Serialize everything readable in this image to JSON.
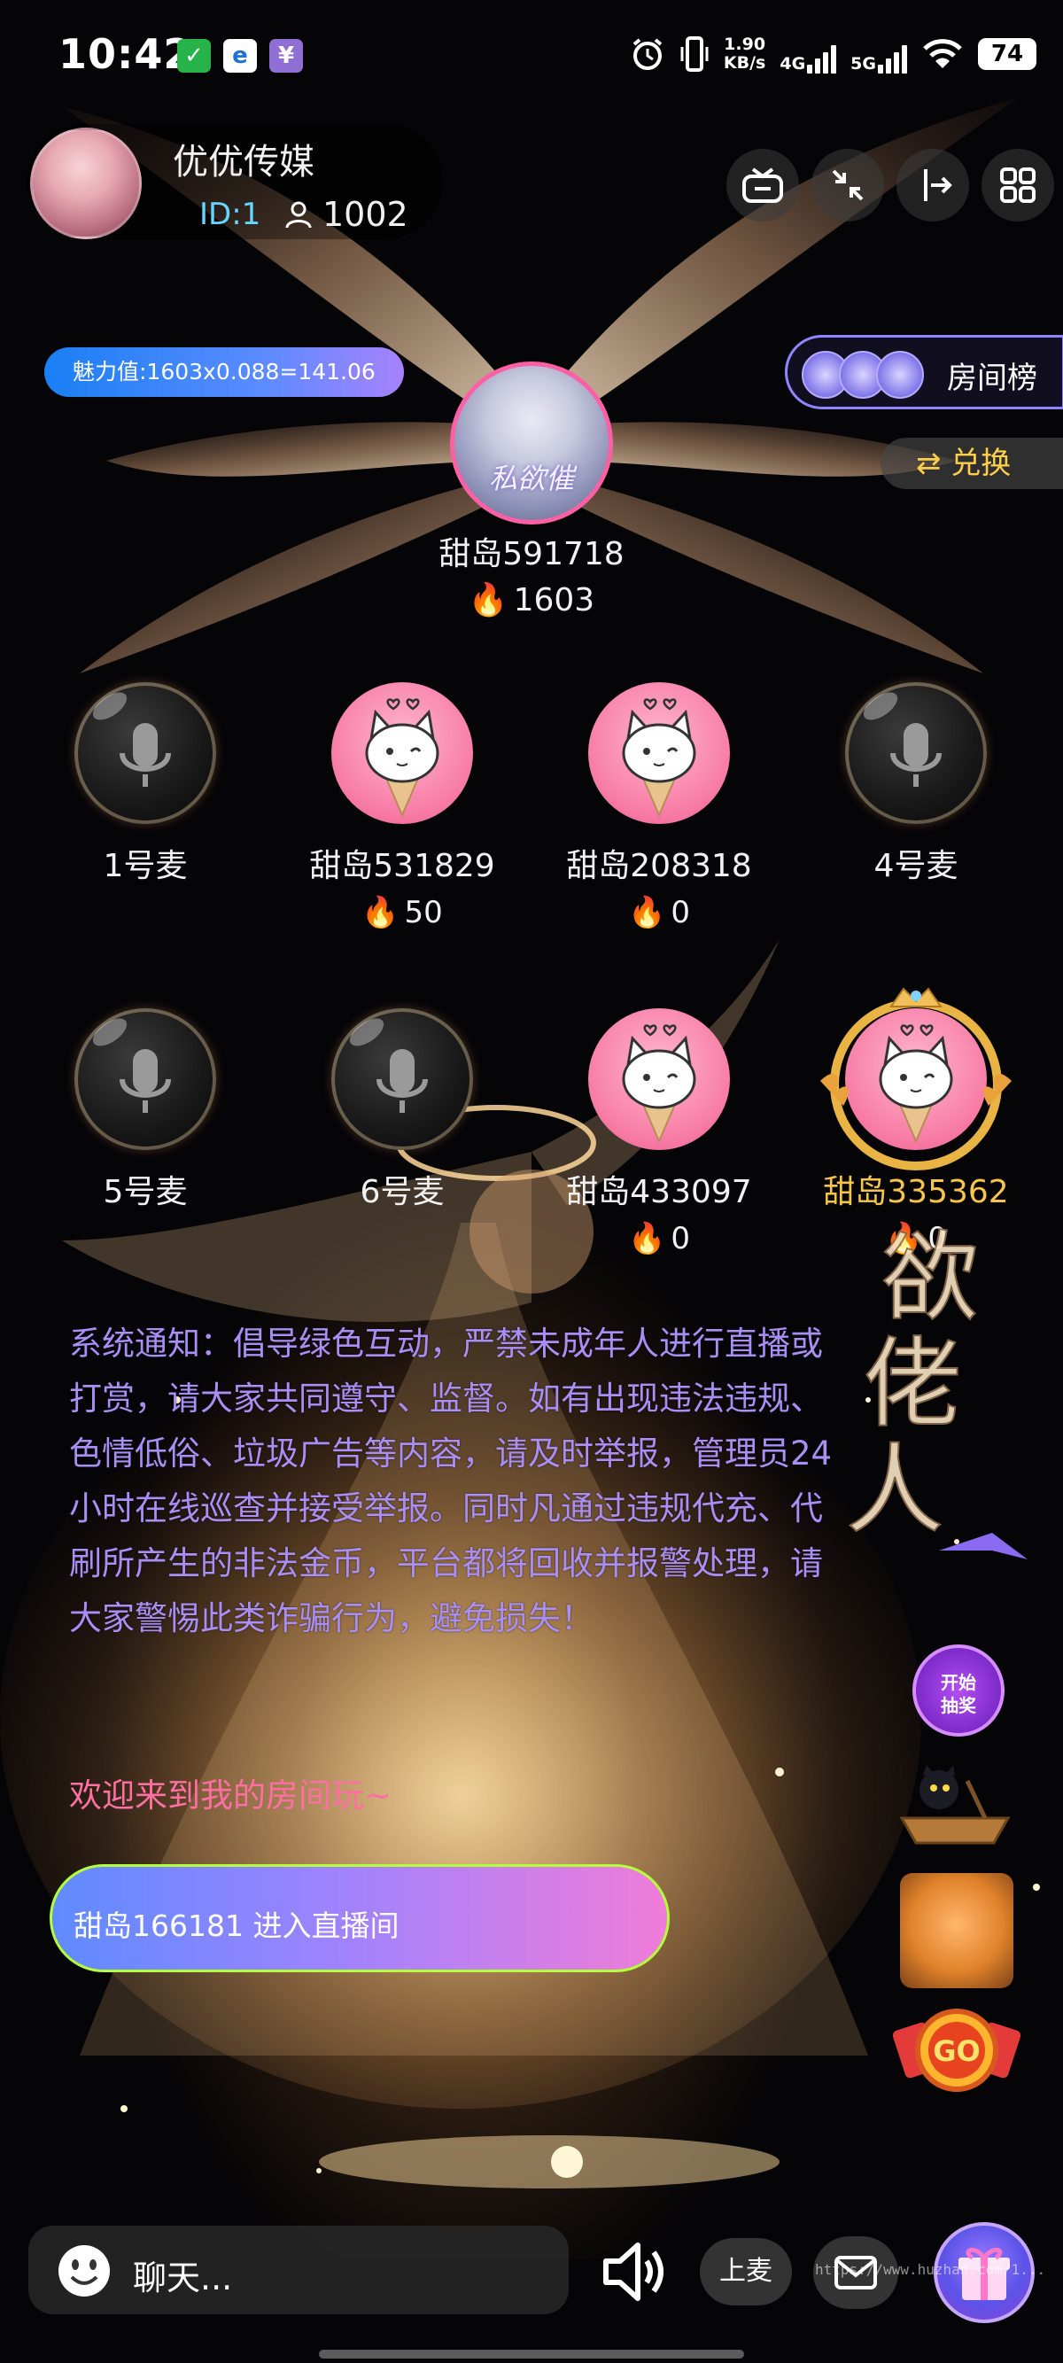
{
  "status_bar": {
    "time": "10:42",
    "speed_value": "1.90",
    "speed_unit": "KB/s",
    "network_1": "4G",
    "network_2": "5G",
    "battery": "74",
    "notification_icons": [
      "wechat-check-icon",
      "browser-icon",
      "yuan-icon"
    ]
  },
  "room": {
    "name": "优优传媒",
    "id_label": "ID:1",
    "online_count": "1002",
    "charm_value": "魅力值:1603x0.088=141.06",
    "rank_label": "房间榜",
    "exchange_label": "兑换",
    "top_icons": [
      "mini-window-icon",
      "collapse-icon",
      "exit-icon",
      "grid-menu-icon"
    ]
  },
  "host": {
    "avatar_caption": "私欲催",
    "name": "甜岛591718",
    "heat": "1603"
  },
  "seats": [
    {
      "label": "1号麦",
      "heat": "",
      "type": "empty"
    },
    {
      "label": "甜岛531829",
      "heat": "50",
      "type": "cat"
    },
    {
      "label": "甜岛208318",
      "heat": "0",
      "type": "cat"
    },
    {
      "label": "4号麦",
      "heat": "",
      "type": "empty"
    },
    {
      "label": "5号麦",
      "heat": "",
      "type": "empty"
    },
    {
      "label": "6号麦",
      "heat": "",
      "type": "empty"
    },
    {
      "label": "甜岛433097",
      "heat": "0",
      "type": "cat"
    },
    {
      "label": "甜岛335362",
      "heat": "0",
      "type": "cat-crown"
    }
  ],
  "messages": {
    "system_notice": "系统通知：倡导绿色互动，严禁未成年人进行直播或打赏，请大家共同遵守、监督。如有出现违法违规、色情低俗、垃圾广告等内容，请及时举报，管理员24小时在线巡查并接受举报。同时凡通过违规代充、代刷所产生的非法金币，平台都将回收并报警处理，请大家警惕此类诈骗行为，避免损失！",
    "welcome": "欢迎来到我的房间玩~",
    "enter_notice": "甜岛166181  进入直播间"
  },
  "side": {
    "title_art": "欲佬人",
    "lottery_line1": "开始",
    "lottery_line2": "抽奖",
    "go_label": "GO"
  },
  "bottom_bar": {
    "chat_placeholder": "聊天...",
    "mic_up_label": "上麦",
    "watermark": "https://www.huzhan.com/1..."
  },
  "colors": {
    "notice_text": "#a98ef5",
    "welcome_text": "#ff6fa2",
    "gold_name": "#f6c54a",
    "exchange_text": "#ffcf4a"
  }
}
